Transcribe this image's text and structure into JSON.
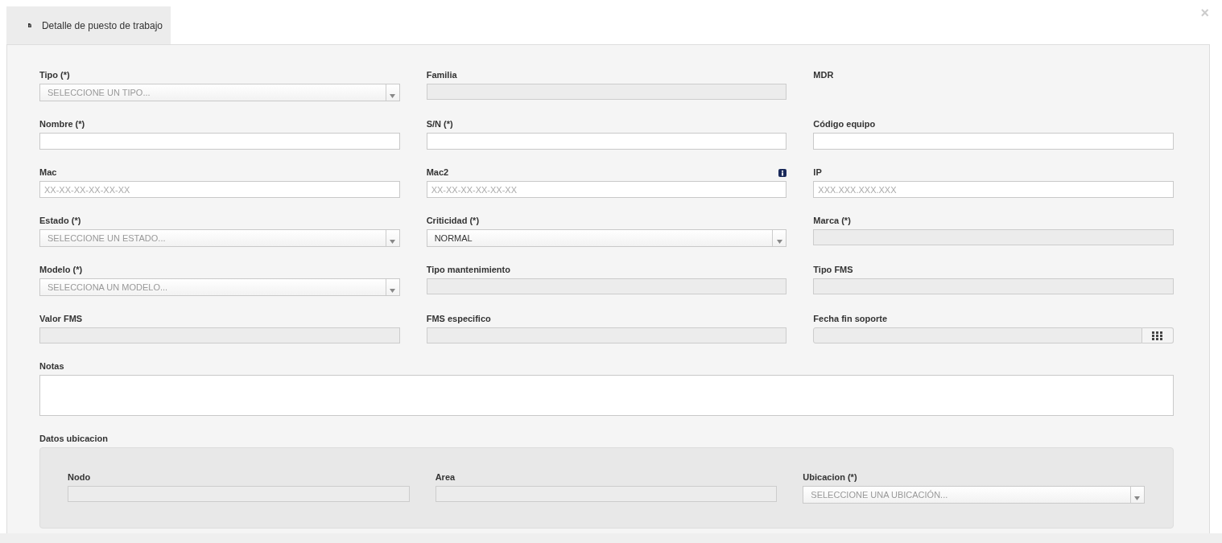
{
  "tab": {
    "label": "Detalle de puesto de trabajo",
    "selected": true
  },
  "close": "×",
  "fields": [
    {
      "label": "Tipo (*)",
      "kind": "select",
      "placeholder": "SELECCIONE UN TIPO..."
    },
    {
      "label": "Familia",
      "kind": "readonly"
    },
    {
      "label": "MDR",
      "kind": "none"
    },
    {
      "label": "Nombre (*)",
      "kind": "text"
    },
    {
      "label": "S/N (*)",
      "kind": "text"
    },
    {
      "label": "Código equipo",
      "kind": "text"
    },
    {
      "label": "Mac",
      "kind": "text",
      "placeholder": "XX-XX-XX-XX-XX-XX"
    },
    {
      "label": "Mac2",
      "kind": "text",
      "placeholder": "XX-XX-XX-XX-XX-XX",
      "info": true
    },
    {
      "label": "IP",
      "kind": "text",
      "placeholder": "XXX.XXX.XXX.XXX"
    },
    {
      "label": "Estado (*)",
      "kind": "select",
      "placeholder": "SELECCIONE UN ESTADO..."
    },
    {
      "label": "Criticidad (*)",
      "kind": "select",
      "value": "NORMAL"
    },
    {
      "label": "Marca (*)",
      "kind": "readonly"
    },
    {
      "label": "Modelo (*)",
      "kind": "select",
      "placeholder": "SELECCIONA UN MODELO..."
    },
    {
      "label": "Tipo mantenimiento",
      "kind": "readonly"
    },
    {
      "label": "Tipo FMS",
      "kind": "readonly"
    },
    {
      "label": "Valor FMS",
      "kind": "readonly"
    },
    {
      "label": "FMS especifico",
      "kind": "readonly"
    },
    {
      "label": "Fecha fin soporte",
      "kind": "date"
    }
  ],
  "notes": {
    "label": "Notas"
  },
  "location": {
    "title": "Datos ubicacion",
    "fields": [
      {
        "label": "Nodo",
        "kind": "readonly"
      },
      {
        "label": "Area",
        "kind": "readonly"
      },
      {
        "label": "Ubicacion (*)",
        "kind": "select",
        "placeholder": "SELECCIONE UNA UBICACIÓN..."
      }
    ]
  }
}
